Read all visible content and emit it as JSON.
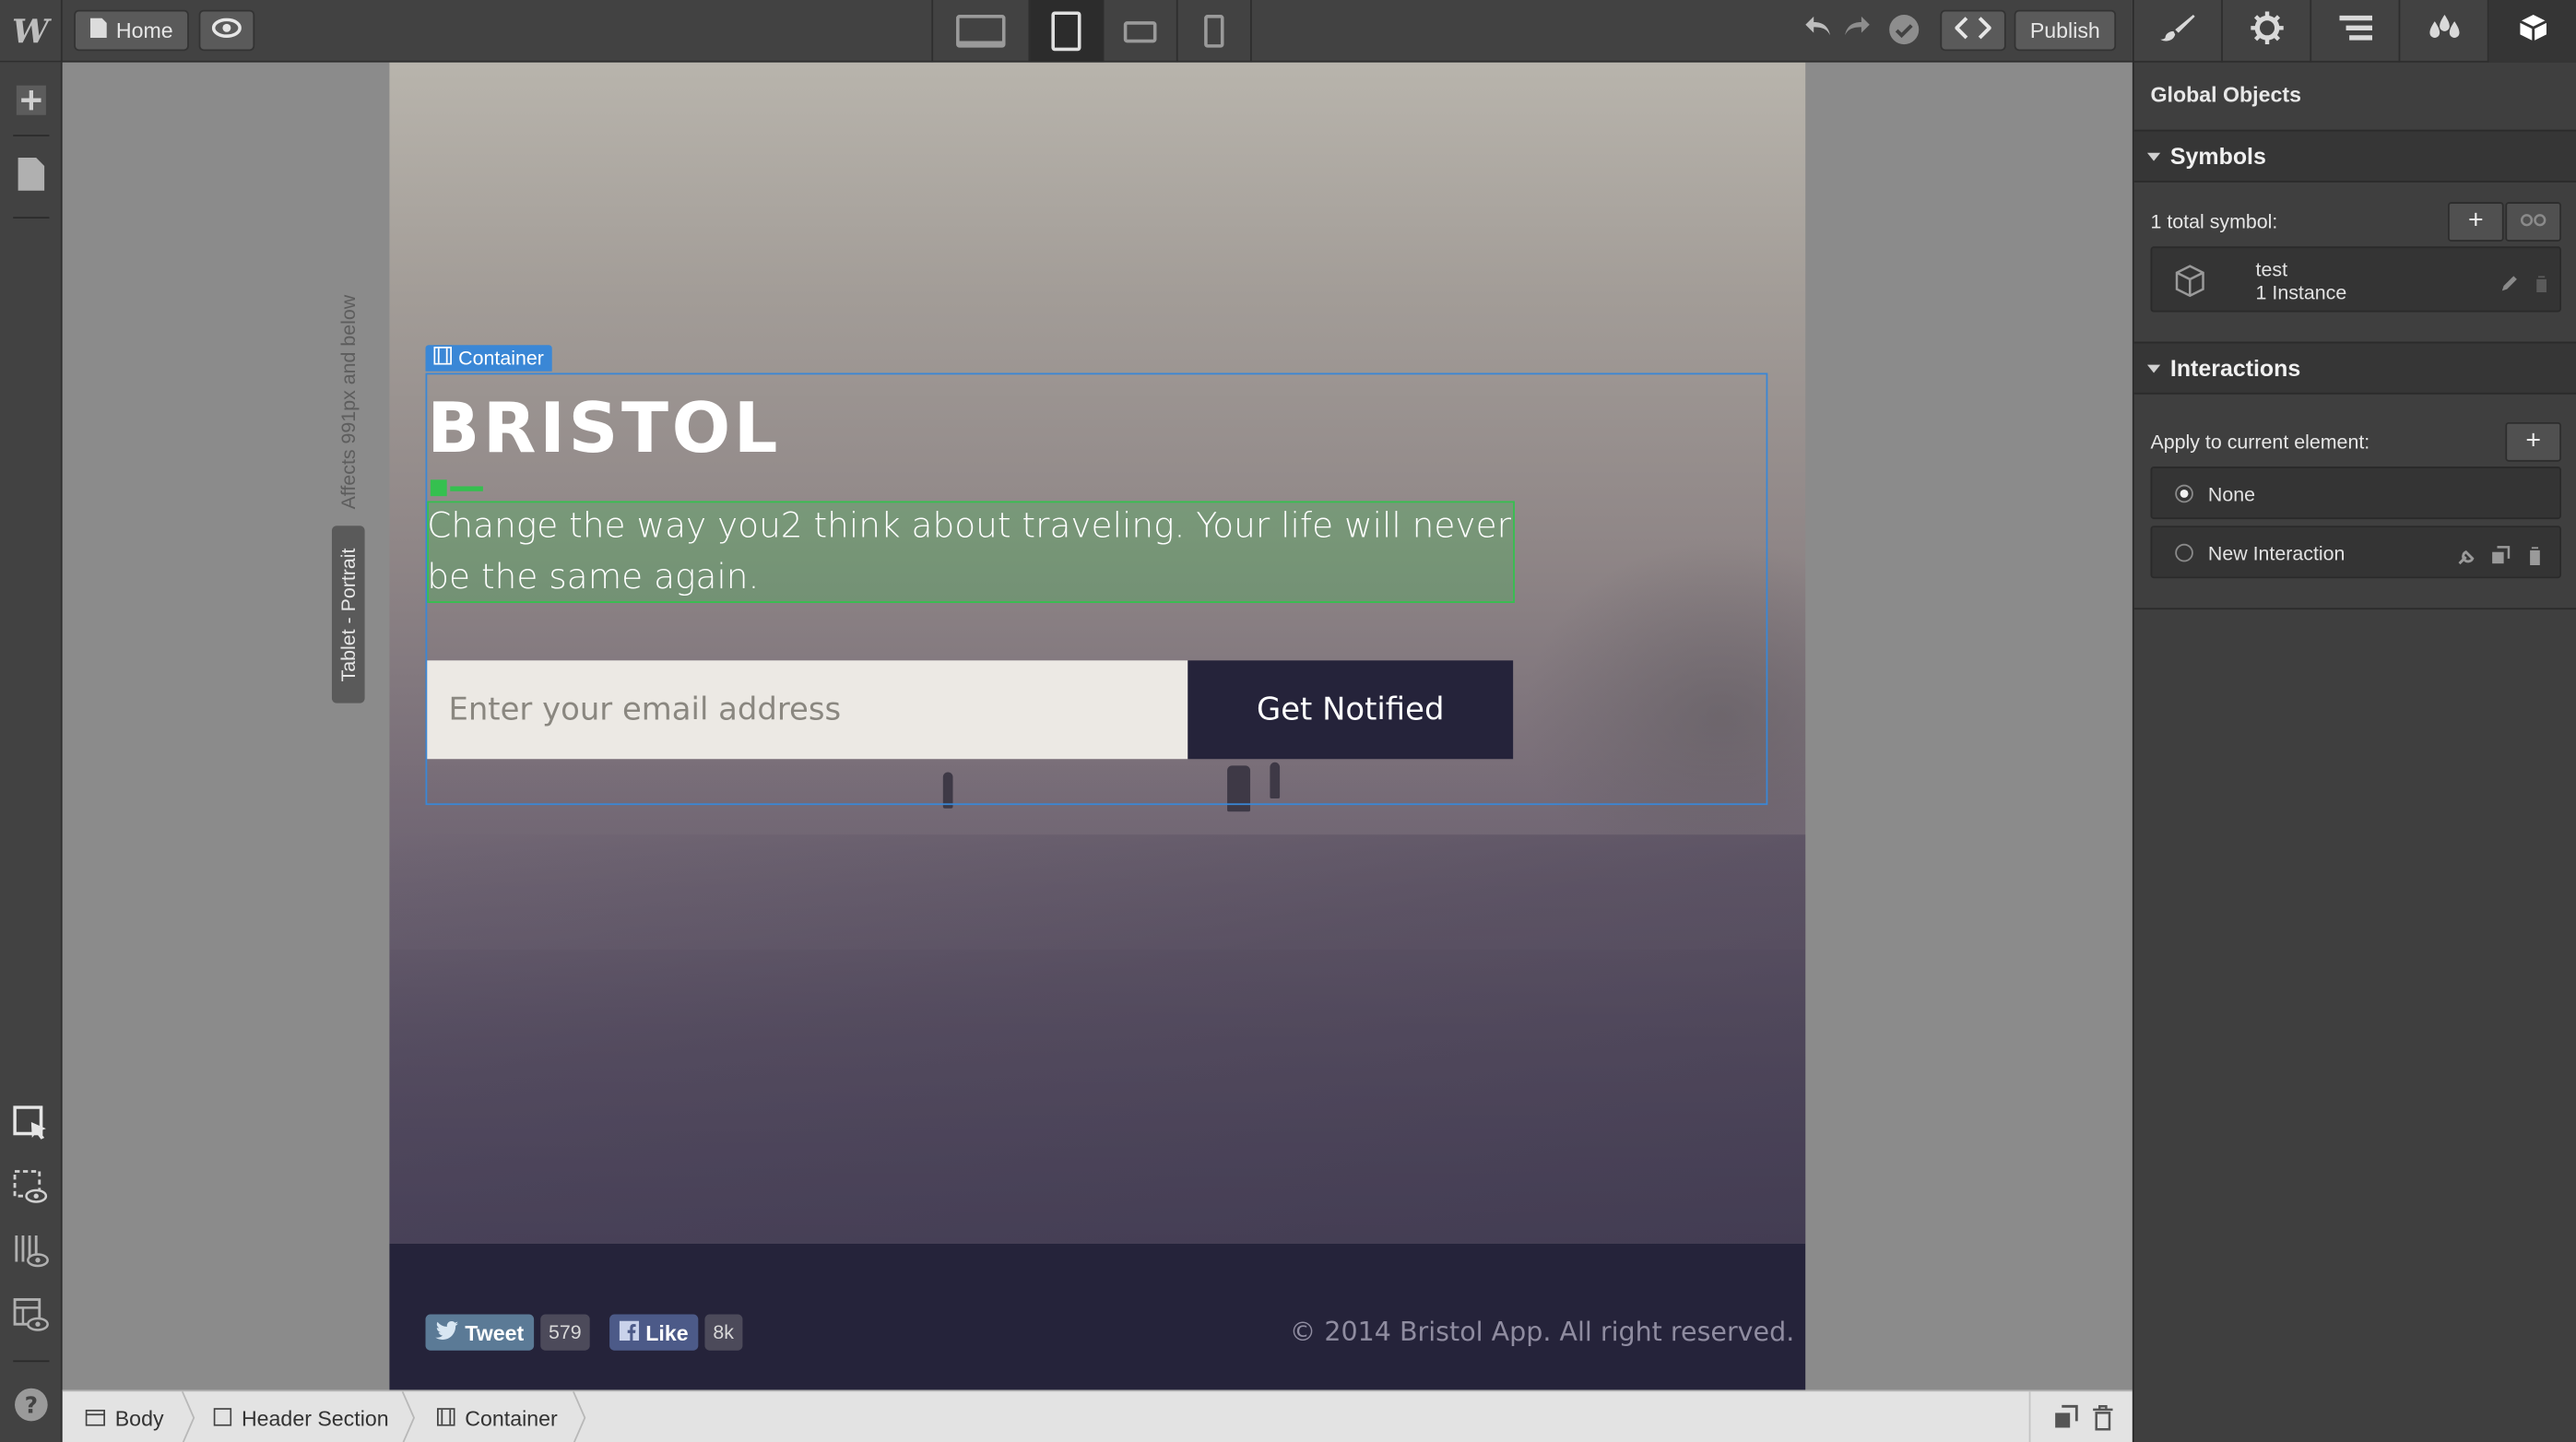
{
  "topbar": {
    "logo": "W",
    "home_label": "Home",
    "publish_label": "Publish",
    "devices": [
      "desktop",
      "tablet-portrait",
      "mobile-landscape",
      "mobile-portrait"
    ]
  },
  "canvas": {
    "viewport_affects": "Affects 991px and below",
    "viewport_name": "Tablet - Portrait",
    "selection_label": "Container"
  },
  "site": {
    "brand": "BRISTOL",
    "tagline": "Change the way you2 think about traveling. Your life will never be the same again.",
    "email_placeholder": "Enter your email address",
    "notify_label": "Get Notified",
    "tweet_label": "Tweet",
    "tweet_count": "579",
    "like_label": "Like",
    "like_count": "8k",
    "copyright": "© 2014 Bristol App. All right reserved."
  },
  "breadcrumb": {
    "items": [
      {
        "label": "Body"
      },
      {
        "label": "Header Section"
      },
      {
        "label": "Container"
      }
    ]
  },
  "panel": {
    "title": "Global Objects",
    "symbols": {
      "section_label": "Symbols",
      "total_label": "1 total symbol:",
      "symbol_name": "test",
      "symbol_instances": "1 Instance"
    },
    "interactions": {
      "section_label": "Interactions",
      "apply_label": "Apply to current element:",
      "options": [
        "None",
        "New Interaction"
      ]
    }
  },
  "colors": {
    "selection_blue": "#3a87d6",
    "text_selection_green": "#35c04f",
    "site_dark": "#25233a",
    "ui_dark": "#424242"
  }
}
